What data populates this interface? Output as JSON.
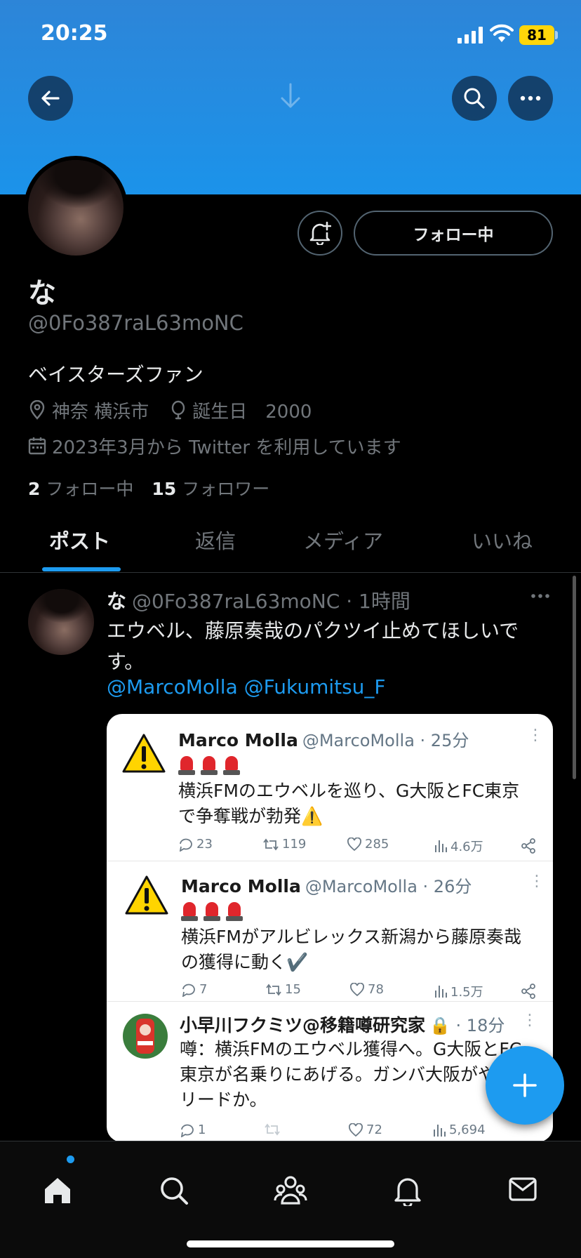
{
  "status_bar": {
    "time": "20:25",
    "battery": "81"
  },
  "profile": {
    "display_name": "な",
    "handle": "@0Fo387raL63moNC",
    "bio": "ベイスターズファン",
    "location": "神奈 横浜市",
    "birthday": "誕生日　2000",
    "joined": "2023年3月から Twitter を利用しています",
    "following_count": "2",
    "following_label": "フォロー中",
    "followers_count": "15",
    "followers_label": "フォロワー",
    "follow_button": "フォロー中"
  },
  "tabs": [
    {
      "label": "ポスト",
      "active": true
    },
    {
      "label": "返信",
      "active": false
    },
    {
      "label": "メディア",
      "active": false
    },
    {
      "label": "いいね",
      "active": false
    }
  ],
  "post": {
    "name": "な",
    "handle": "@0Fo387raL63moNC",
    "time": "1時間",
    "text": "エウベル、藤原奏哉のパクツイ止めてほしいです。",
    "mentions": "@MarcoMolla @Fukumitsu_F"
  },
  "quoted_tweets": [
    {
      "name": "Marco Molla",
      "handle": "@MarcoMolla · 25分",
      "text_line1": "横浜FMのエウベルを巡り、G大阪とFC東京",
      "text_line2": "で争奪戦が勃発⚠️",
      "replies": "23",
      "retweets": "119",
      "likes": "285",
      "views": "4.6万"
    },
    {
      "name": "Marco Molla",
      "handle": "@MarcoMolla · 26分",
      "text_line1": "横浜FMがアルビレックス新潟から藤原奏哉",
      "text_line2": "の獲得に動く✔️",
      "replies": "7",
      "retweets": "15",
      "likes": "78",
      "views": "1.5万"
    },
    {
      "name": "小早川フクミツ@移籍噂研究家",
      "handle": "· 18分",
      "text_line1": "噂：横浜FMのエウベル獲得へ。G大阪とFC",
      "text_line2": "東京が名乗りにあげる。ガンバ大阪がやや",
      "text_line3": "リードか。",
      "replies": "1",
      "retweets": "",
      "likes": "72",
      "views": "5,694"
    }
  ],
  "colors": {
    "accent": "#1d9bf0",
    "banner": "#1b93ea",
    "background": "#000000"
  },
  "icons": [
    "back-icon",
    "search-icon",
    "more-icon",
    "bell-plus-icon",
    "location-icon",
    "birthday-icon",
    "calendar-icon",
    "compose-icon",
    "home-icon",
    "communities-icon",
    "notifications-icon",
    "messages-icon"
  ]
}
